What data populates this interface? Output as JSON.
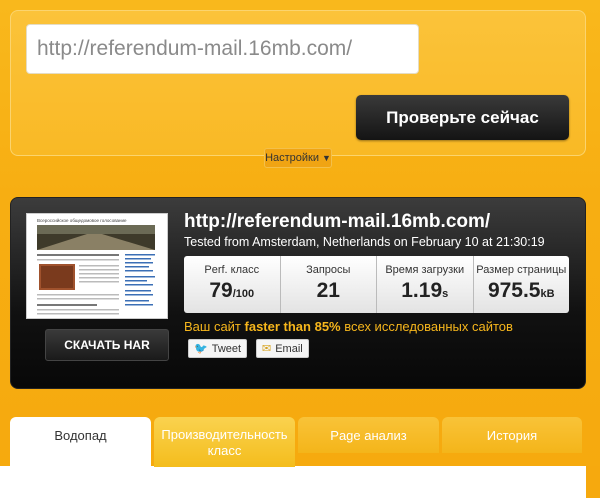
{
  "form": {
    "url_value": "http://referendum-mail.16mb.com/",
    "check_label": "Проверьте сейчас",
    "settings_label": "Настройки"
  },
  "result": {
    "url": "http://referendum-mail.16mb.com/",
    "tested_from": "Tested from Amsterdam, Netherlands on February 10 at 21:30:19",
    "har_label": "СКАЧАТЬ HAR",
    "metrics": [
      {
        "label": "Perf. класс",
        "value": "79",
        "unit": "/100"
      },
      {
        "label": "Запросы",
        "value": "21",
        "unit": ""
      },
      {
        "label": "Время загрузки",
        "value": "1.19",
        "unit": "s"
      },
      {
        "label": "Размер страницы",
        "value": "975.5",
        "unit": "kB"
      }
    ],
    "summary_prefix": "Ваш сайт",
    "summary_bold": "faster than 85%",
    "summary_suffix": "всех исследованных сайтов",
    "tweet_label": "Tweet",
    "email_label": "Email"
  },
  "thumbnail": {
    "title": "Всероссийское общедомовое голосование"
  },
  "tabs": [
    {
      "label": "Водопад"
    },
    {
      "label": "Производительность класс"
    },
    {
      "label": "Page анализ"
    },
    {
      "label": "История"
    }
  ],
  "colors": {
    "accent": "#f6b61c",
    "background": "#f6a90e",
    "panel": "#111111"
  }
}
